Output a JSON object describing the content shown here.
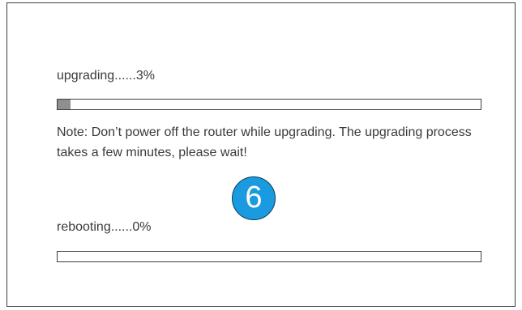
{
  "upgrade": {
    "label": "upgrading......3%",
    "progress_percent": 3
  },
  "note": {
    "text": "Note: Don’t power off the router while upgrading. The upgrading process takes a few minutes, please wait!"
  },
  "step_badge": {
    "number": "6",
    "color": "#1a9be0"
  },
  "reboot": {
    "label": "rebooting......0%",
    "progress_percent": 0
  },
  "colors": {
    "border": "#3d3d3d",
    "progress_fill": "#8f8f8f",
    "text": "#3a3a3a"
  }
}
